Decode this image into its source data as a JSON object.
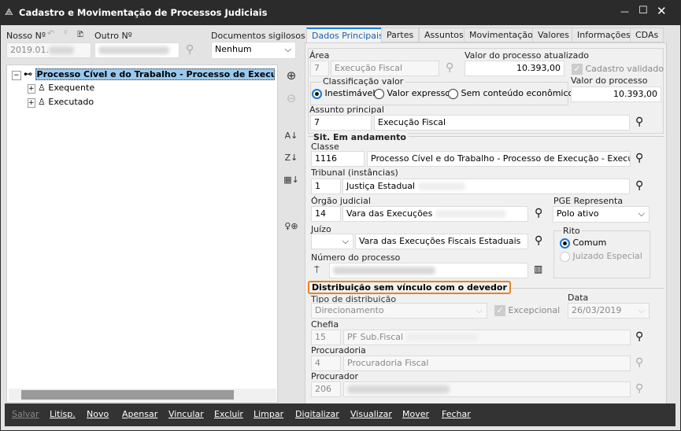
{
  "window": {
    "title": "Cadastro e Movimentação de Processos Judiciais",
    "minimize": "—",
    "maximize": "☐",
    "close": "✕"
  },
  "left": {
    "nosso_label": "Nosso Nº",
    "nosso_value": "2019.01.",
    "outro_label": "Outro Nº",
    "docs_label": "Documentos sigilosos",
    "docs_value": "Nenhum",
    "tree": {
      "root": "Processo Cível e do Trabalho - Processo de Execução - Exe",
      "children": [
        "Exequente",
        "Executado"
      ]
    }
  },
  "tabs": [
    "Dados Principais",
    "Partes",
    "Assuntos",
    "Movimentação",
    "Valores",
    "Informações",
    "CDAs"
  ],
  "form": {
    "area_label": "Área",
    "area_code": "7",
    "area_value": "Execução Fiscal",
    "valor_atualizado_label": "Valor do processo atualizado",
    "valor_atualizado": "10.393,00",
    "cadastro_validado": "Cadastro validado",
    "classificacao_label": "Classificação valor",
    "classificacao_options": [
      "Inestimável",
      "Valor expresso",
      "Sem conteúdo econômico"
    ],
    "valor_processo_label": "Valor do processo",
    "valor_processo": "10.393,00",
    "assunto_label": "Assunto principal",
    "assunto_code": "7",
    "assunto_value": "Execução Fiscal",
    "situacao": "Sit.  Em andamento",
    "classe_label": "Classe",
    "classe_code": "1116",
    "classe_value": "Processo Cível e do Trabalho - Processo de Execução - Execução F",
    "tribunal_label": "Tribunal (instâncias)",
    "tribunal_code": "1",
    "tribunal_value": "Justiça Estadual",
    "orgao_label": "Órgão judicial",
    "orgao_code": "14",
    "orgao_value": "Varа das Execuções",
    "pge_label": "PGE Representa",
    "pge_value": "Polo ativo",
    "juizo_label": "Juízo",
    "juizo_value": "Vara das Execuções Fiscais Estaduais",
    "rito_label": "Rito",
    "rito_options": [
      "Comum",
      "Juizado Especial"
    ],
    "numero_label": "Número do processo",
    "distrib_title": "Distribuição sem vínculo com o devedor",
    "tipo_label": "Tipo de distribuição",
    "tipo_value": "Direcionamento",
    "excepcional": "Excepcional",
    "data_label": "Data",
    "data_value": "26/03/2019",
    "chefia_label": "Chefia",
    "chefia_code": "15",
    "chefia_value": "PF Sub.Fiscal",
    "procuradoria_label": "Procuradoria",
    "procuradoria_code": "4",
    "procuradoria_value": "Procuradoria Fiscal",
    "procurador_label": "Procurador",
    "procurador_code": "206"
  },
  "toolbar": [
    "Salvar",
    "Litisp.",
    "Novo",
    "Apensar",
    "Vincular",
    "Excluir",
    "Limpar",
    "Digitalizar",
    "Visualizar",
    "Mover",
    "Fechar"
  ],
  "colors": {
    "accent": "#1a7ad4",
    "highlight": "#e8821e",
    "selection": "#99c9ef"
  }
}
